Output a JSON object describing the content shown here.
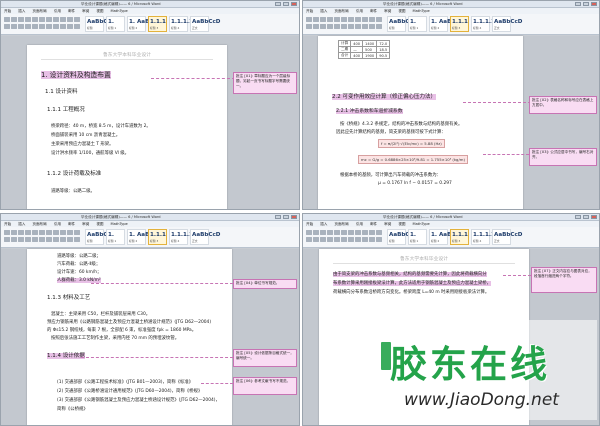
{
  "window_title": "毕业设计课题(格式编辑)—— 6 / Microsoft Word",
  "menu": [
    "开始",
    "插入",
    "页面布局",
    "引用",
    "邮件",
    "审阅",
    "视图",
    "MathType"
  ],
  "styles": [
    {
      "preview": "AaBbC",
      "name": "标题"
    },
    {
      "preview": "1.",
      "name": "标题 1"
    },
    {
      "preview": "1. AaB",
      "name": "标题 2"
    },
    {
      "preview": "1.1.1",
      "name": "标题 3"
    },
    {
      "preview": "1.1.1.1",
      "name": "标题 4"
    },
    {
      "preview": "AaBbCcD",
      "name": "正文"
    }
  ],
  "page_header": "鲁东大学本科毕业设计",
  "panel0": {
    "heading1": "1. 设计资料及构造布置",
    "heading2": "1.1 设计资料",
    "heading3": "1.1.1 工程概况",
    "body": [
      "桥梁跨径：40 m，桥宽 8.5 m，设计车道数为 2。",
      "桥面铺装采用 10 cm 沥青混凝土。",
      "主梁采用预应力混凝土 T 形梁。",
      "设计洪水频率 1/100，通航等级 Ⅵ 级。"
    ],
    "heading3b": "1.1.2 设计荷载及标准",
    "body2": "道路等级：公路二级。",
    "comment": "批注 [X1]: 章标题应为一个层级标题，另起一页书写标题字号需要统一。"
  },
  "panel1": {
    "table": [
      [
        "计算",
        "400",
        "1400",
        "72.0"
      ],
      [
        "二期",
        "—",
        "500",
        "18.5"
      ],
      [
        "合计",
        "400",
        "1900",
        "90.5"
      ]
    ],
    "heading2": "2.2 可变作用效应计算（修正偏心压力法）",
    "heading3": "2.2.1 冲击系数和车道折减系数",
    "body": [
      "按《桥规》4.3.2 条规定，结构的冲击系数与结构的基频有关。",
      "因此应先计算结构的基频，简支梁的基频可按下式计算："
    ],
    "formula1": "f = π/(2l²)·√(EIc/mc) = 5.88 (Hz)",
    "formula2": "mc = G/g = 0.6886×25×10³/9.81 = 1.755×10³ (kg/m)",
    "body2": "根据本桥的基频，可计算出汽车荷载的冲击系数为：",
    "body3": "μ = 0.1767 ln f − 0.0157 = 0.297",
    "comment1": "批注 [X2]: 表格名称和标号应在表格上方居中。",
    "comment2": "批注 [X3]: 公式应居中书写，编号右对齐。"
  },
  "panel2": {
    "lines": [
      "道路等级：公路二级；",
      "汽车荷载：公路-Ⅱ级；",
      "设计车速：60 km/h；",
      "人群荷载：3.0 kN/m²"
    ],
    "heading3": "1.1.3 材料及工艺",
    "body": [
      "混凝土：主梁采用 C50，栏杆及铺装层采用 C30。",
      "预应力钢筋采用《公路钢筋混凝土及预应力混凝土桥涵设计规范》(JTG D62—2004)",
      "的 Φs15.2 钢绞线，每束 7 根，全部配 6 束，标准强度 fpk = 1860 MPa。",
      "按照后张法施工工艺制作主梁，采用内径 70 mm 的预埋波纹管。"
    ],
    "heading3b": "1.1.4 设计依据",
    "refs": [
      "(1) 交通部部《公路工程技术标准》(JTG B01—2003)，简称《标准》",
      "(2) 交通部部《公路桥涵设计通用规范》(JTG D60—2004)，简称《桥规》",
      "(3) 交通部部《公路钢筋混凝土及预应力混凝土桥涵设计规范》(JTG D62—2004)，",
      "简称《公桥规》"
    ],
    "comment1": "批注 [X4]: 单位书写规范。",
    "comment2": "批注 [X5]: 设计依据条目格式统一，编号统一。",
    "comment3": "批注 [X6]: 参考文献书写不规范。"
  },
  "panel3": {
    "body": [
      "由于简支梁的冲击系数与基频相关，结构的基频需要先计算，因此将荷载横向分",
      "布系数计算采用刚接板梁法计算，此方法适用于钢筋混凝土及预应力混凝土梁桥，",
      "荷载横向分布系数沿桥跨方向变化。桥梁跨度 L=40 m 时采用刚接板梁法计算。"
    ],
    "comment": "批注 [X7]: 正文内容应与图表对应，段落首行缩进两个字符。"
  },
  "watermark": {
    "logo": "胶东在线",
    "url": "www.JiaoDong.net"
  }
}
